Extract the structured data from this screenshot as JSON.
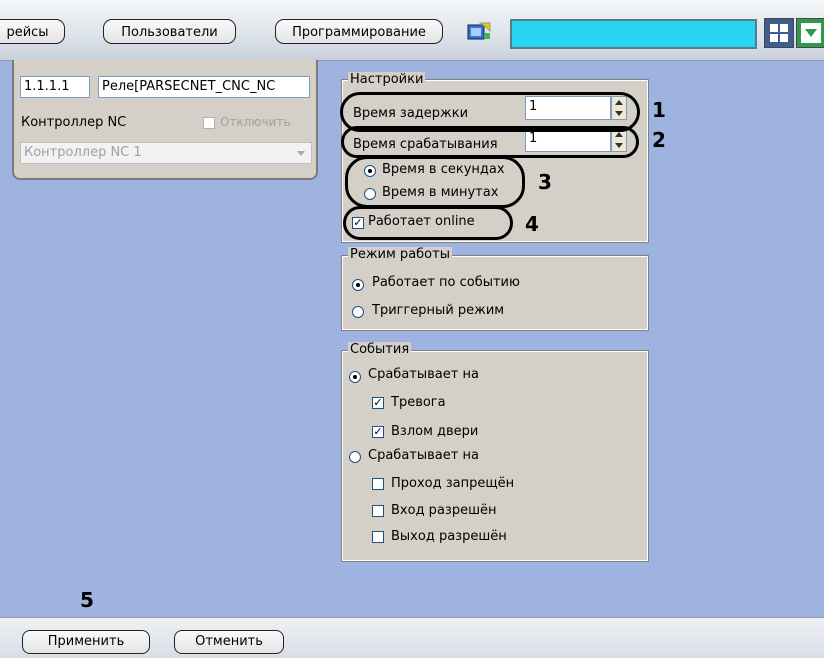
{
  "topbar": {
    "tabs": [
      "рейсы",
      "Пользователи",
      "Программирование"
    ],
    "accent_color": "#29d4f2"
  },
  "panel": {
    "address": "1.1.1.1",
    "name": "Реле[PARSECNET_CNC_NC",
    "controller_label": "Контроллер NC",
    "disable_label": "Отключить",
    "controller_select": "Контроллер NC 1"
  },
  "settings": {
    "title": "Настройки",
    "delay_label": "Время задержки",
    "delay_value": "1",
    "trigger_label": "Время срабатывания",
    "trigger_value": "1",
    "seconds_label": "Время в секундах",
    "minutes_label": "Время в минутах",
    "online_label": "Работает online"
  },
  "mode": {
    "title": "Режим работы",
    "by_event_label": "Работает по событию",
    "trigger_mode_label": "Триггерный режим"
  },
  "events": {
    "title": "События",
    "group1_label": "Срабатывает на",
    "alarm_label": "Тревога",
    "door_break_label": "Взлом двери",
    "group2_label": "Срабатывает на",
    "pass_denied_label": "Проход запрещён",
    "entry_allowed_label": "Вход разрешён",
    "exit_allowed_label": "Выход разрешён"
  },
  "callouts": [
    "1",
    "2",
    "3",
    "4",
    "5"
  ],
  "bottombar": {
    "apply_label": "Применить",
    "cancel_label": "Отменить"
  }
}
